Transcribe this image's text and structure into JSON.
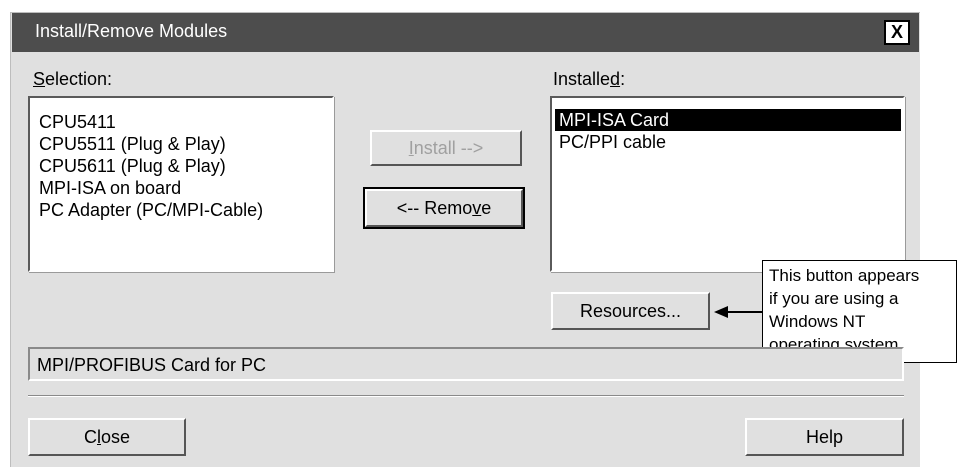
{
  "dialog": {
    "title": "Install/Remove Modules",
    "close_glyph": "X"
  },
  "selection": {
    "label_pre": "",
    "label_ul": "S",
    "label_post": "election:",
    "items": [
      "CPU5411",
      "CPU5511 (Plug & Play)",
      "CPU5611 (Plug & Play)",
      "MPI-ISA on board",
      "PC Adapter (PC/MPI-Cable)"
    ]
  },
  "installed": {
    "label_pre": "Installe",
    "label_ul": "d",
    "label_post": ":",
    "items": [
      "MPI-ISA Card",
      "PC/PPI cable"
    ],
    "selected_index": 0
  },
  "buttons": {
    "install": {
      "pre": "",
      "ul": "I",
      "post": "nstall -->"
    },
    "remove": {
      "pre": "<-- Remo",
      "ul": "v",
      "post": "e"
    },
    "resources": "Resources...",
    "close": {
      "pre": "C",
      "ul": "l",
      "post": "ose"
    },
    "help": "Help"
  },
  "description": "MPI/PROFIBUS Card for PC",
  "callout": "This button appears\nif you are using a\nWindows NT\noperating system.",
  "icons": {
    "close": "close-icon",
    "arrow": "left-arrow-icon"
  }
}
